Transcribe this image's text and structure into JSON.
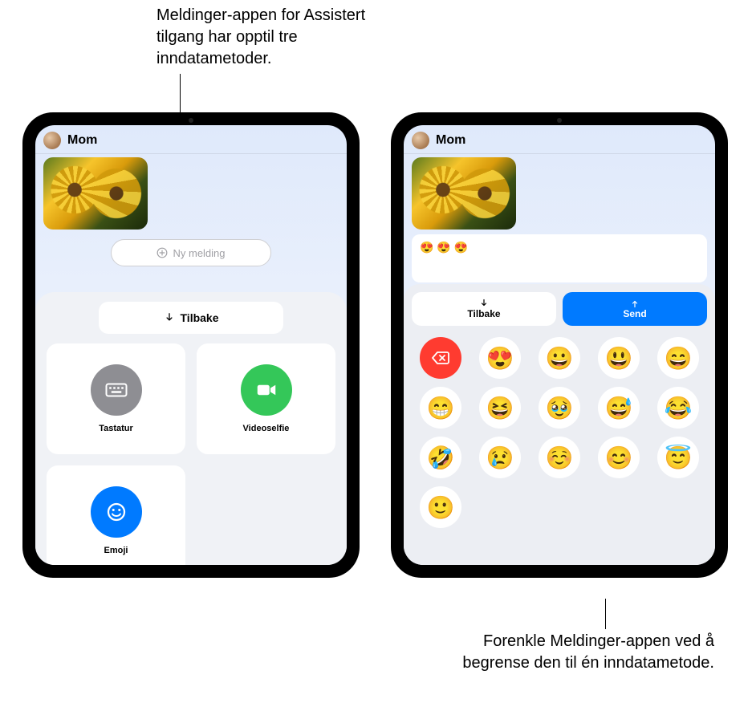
{
  "callouts": {
    "top": "Meldinger-appen for Assistert tilgang har opptil tre inndatametoder.",
    "bottom": "Forenkle Meldinger-appen ved å begrense den til én inndatametode."
  },
  "left": {
    "contact": "Mom",
    "new_message": "Ny melding",
    "back": "Tilbake",
    "inputs": {
      "keyboard": "Tastatur",
      "video": "Videoselfie",
      "emoji": "Emoji"
    }
  },
  "right": {
    "contact": "Mom",
    "compose_value": "😍 😍 😍",
    "back": "Tilbake",
    "send": "Send",
    "emoji": [
      "😍",
      "😀",
      "😃",
      "😄",
      "😁",
      "😆",
      "🥹",
      "😅",
      "😂",
      "🤣",
      "😢",
      "☺️",
      "😊",
      "😇",
      "🙂"
    ]
  }
}
